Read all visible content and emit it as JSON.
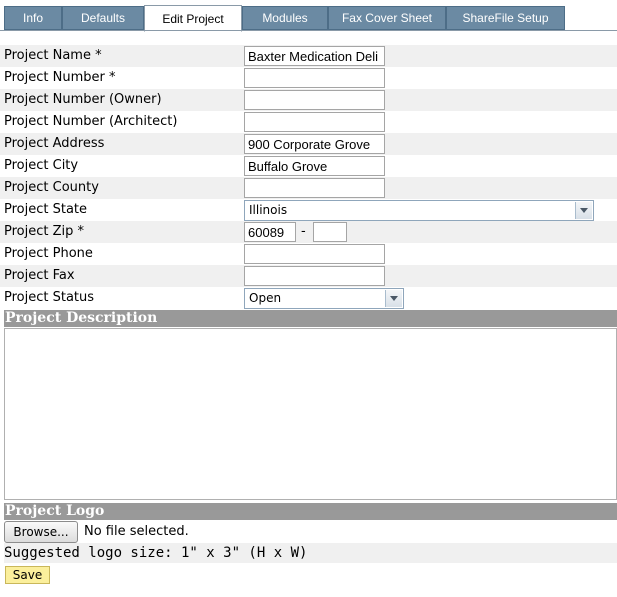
{
  "tabs": [
    "Info",
    "Defaults",
    "Edit Project",
    "Modules",
    "Fax Cover Sheet",
    "ShareFile Setup"
  ],
  "active_tab": "Edit Project",
  "fields": {
    "project_name": {
      "label": "Project Name  *",
      "value": "Baxter Medication Deli"
    },
    "project_number": {
      "label": "Project Number  *",
      "value": ""
    },
    "project_number_owner": {
      "label": "Project Number (Owner)",
      "value": ""
    },
    "project_number_architect": {
      "label": "Project Number (Architect)",
      "value": ""
    },
    "project_address": {
      "label": "Project Address",
      "value": "900 Corporate Grove"
    },
    "project_city": {
      "label": "Project City",
      "value": "Buffalo Grove"
    },
    "project_county": {
      "label": "Project County",
      "value": ""
    },
    "project_state": {
      "label": "Project State",
      "value": "Illinois"
    },
    "project_zip": {
      "label": "Project Zip  *",
      "value": "60089",
      "separator": "-",
      "ext": ""
    },
    "project_phone": {
      "label": "Project Phone",
      "value": ""
    },
    "project_fax": {
      "label": "Project Fax",
      "value": ""
    },
    "project_status": {
      "label": "Project Status",
      "value": "Open"
    }
  },
  "description_section": {
    "title": "Project Description",
    "value": ""
  },
  "logo_section": {
    "title": "Project Logo",
    "browse_label": "Browse...",
    "file_status": "No file selected.",
    "size_hint": "Suggested logo size: 1\" x 3\" (H x W)"
  },
  "save_label": "Save",
  "colors": {
    "tab_bg": "#6b8aa3",
    "section_bg": "#999999",
    "save_bg": "#fbef9c",
    "row_alt": "#f0f0f0"
  }
}
